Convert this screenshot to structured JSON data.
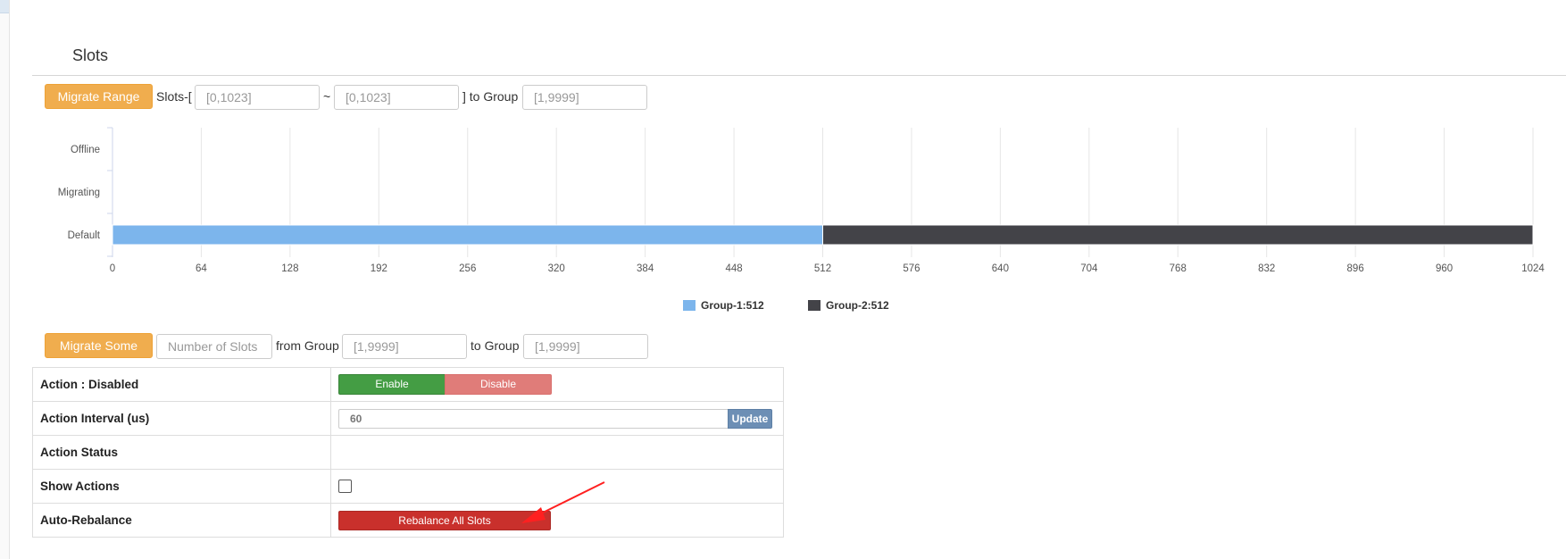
{
  "section_title": "Slots",
  "migrate_range": {
    "button_label": "Migrate Range",
    "prefix_text": "Slots-[",
    "from_placeholder": "[0,1023]",
    "tilde_text": "~",
    "to_placeholder": "[0,1023]",
    "to_group_text": "] to Group",
    "group_placeholder": "[1,9999]"
  },
  "chart_data": {
    "type": "bar",
    "orientation": "horizontal-stacked",
    "categories": [
      "Offline",
      "Migrating",
      "Default"
    ],
    "series": [
      {
        "name": "Group-1:512",
        "color": "#7cb5ec",
        "values": [
          0,
          0,
          512
        ]
      },
      {
        "name": "Group-2:512",
        "color": "#434348",
        "values": [
          0,
          0,
          512
        ]
      }
    ],
    "x_ticks": [
      0,
      64,
      128,
      192,
      256,
      320,
      384,
      448,
      512,
      576,
      640,
      704,
      768,
      832,
      896,
      960,
      1024
    ],
    "xlim": [
      0,
      1024
    ],
    "grid": true,
    "legend_position": "bottom-center"
  },
  "migrate_some": {
    "button_label": "Migrate Some",
    "count_placeholder": "Number of Slots",
    "from_group_text": "from Group",
    "from_placeholder": "[1,9999]",
    "to_group_text": "to Group",
    "to_placeholder": "[1,9999]"
  },
  "props": {
    "action_label": "Action : Disabled",
    "enable_label": "Enable",
    "disable_label": "Disable",
    "interval_label": "Action Interval (us)",
    "interval_value": "60",
    "update_label": "Update",
    "status_label": "Action Status",
    "show_actions_label": "Show Actions",
    "auto_rebalance_label": "Auto-Rebalance",
    "rebalance_label": "Rebalance All Slots"
  }
}
